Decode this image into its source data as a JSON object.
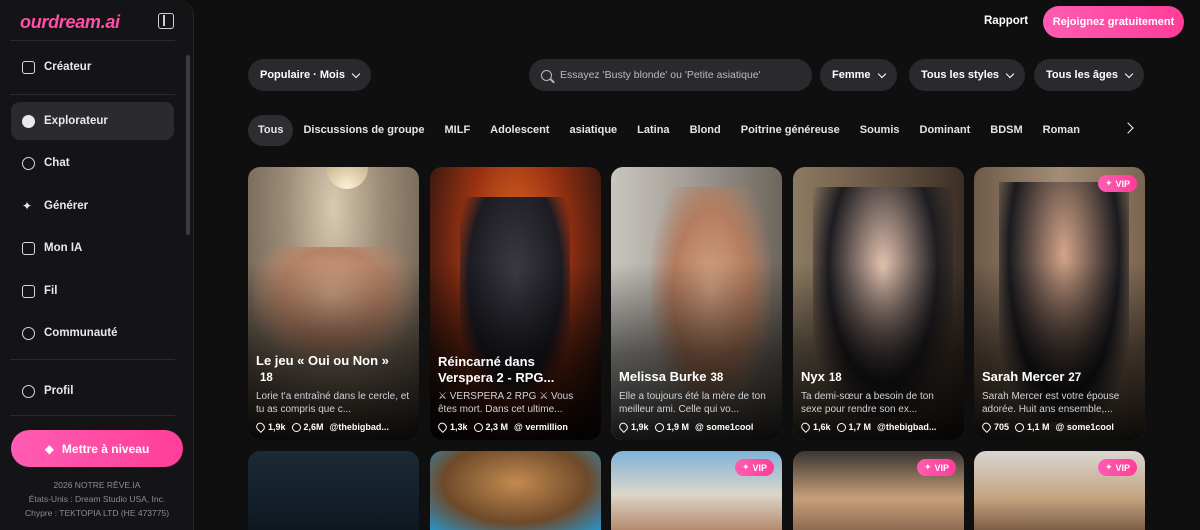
{
  "sidebar": {
    "logo": "ourdream.ai",
    "items": [
      {
        "label": "Créateur",
        "icon": "plus-square-icon"
      },
      {
        "label": "Explorateur",
        "icon": "compass-icon"
      },
      {
        "label": "Chat",
        "icon": "chat-bubble-icon"
      },
      {
        "label": "Générer",
        "icon": "sparkles-icon"
      },
      {
        "label": "Mon IA",
        "icon": "copy-icon"
      },
      {
        "label": "Fil",
        "icon": "play-square-icon"
      },
      {
        "label": "Communauté",
        "icon": "users-icon"
      },
      {
        "label": "Profil",
        "icon": "user-icon"
      }
    ],
    "active": "Explorateur",
    "upgrade_label": "Mettre à niveau",
    "footer": [
      "2026 NOTRE RÊVE.IA",
      "États-Unis : Dream Studio USA, Inc.",
      "Chypre : TEKTOPIA LTD (HE 473775)"
    ]
  },
  "header": {
    "report_label": "Rapport",
    "join_label": "Rejoignez gratuitement"
  },
  "filters": {
    "sort": "Populaire · Mois",
    "search_placeholder": "Essayez 'Busty blonde' ou 'Petite asiatique'",
    "gender": "Femme",
    "style": "Tous les styles",
    "age": "Tous les âges"
  },
  "tags": [
    "Tous",
    "Discussions de groupe",
    "MILF",
    "Adolescent",
    "asiatique",
    "Latina",
    "Blond",
    "Poitrine généreuse",
    "Soumis",
    "Dominant",
    "BDSM",
    "Roman"
  ],
  "cards": [
    {
      "name": "Le jeu « Oui ou Non »",
      "age": "18",
      "desc": "Lorie t'a entraîné dans le cercle, et tu as compris que c...",
      "likes": "1,9k",
      "chats": "2,6M",
      "author": "@thebigbad..."
    },
    {
      "name": "Réincarné dans Verspera 2 - RPG...",
      "age": "",
      "desc": "⚔ VERSPERA 2 RPG ⚔ Vous êtes mort. Dans cet ultime...",
      "likes": "1,3k",
      "chats": "2,3 M",
      "author": "@ vermillion"
    },
    {
      "name": "Melissa Burke",
      "age": "38",
      "desc": "Elle a toujours été la mère de ton meilleur ami. Celle qui vo...",
      "likes": "1,9k",
      "chats": "1,9 M",
      "author": "@ some1cool"
    },
    {
      "name": "Nyx",
      "age": "18",
      "desc": "Ta demi-sœur a besoin de ton sexe pour rendre son ex...",
      "likes": "1,6k",
      "chats": "1,7 M",
      "author": "@thebigbad..."
    },
    {
      "name": "Sarah Mercer",
      "age": "27",
      "desc": "Sarah Mercer est votre épouse adorée. Huit ans ensemble,...",
      "likes": "705",
      "chats": "1,1 M",
      "author": "@ some1cool",
      "vip": "VIP"
    }
  ],
  "row2_badges": {
    "vip": "VIP"
  },
  "colors": {
    "accent": "#ff4fa7",
    "background": "#0f0f10",
    "sidebar": "#141416",
    "pill": "#2a2a2e"
  }
}
